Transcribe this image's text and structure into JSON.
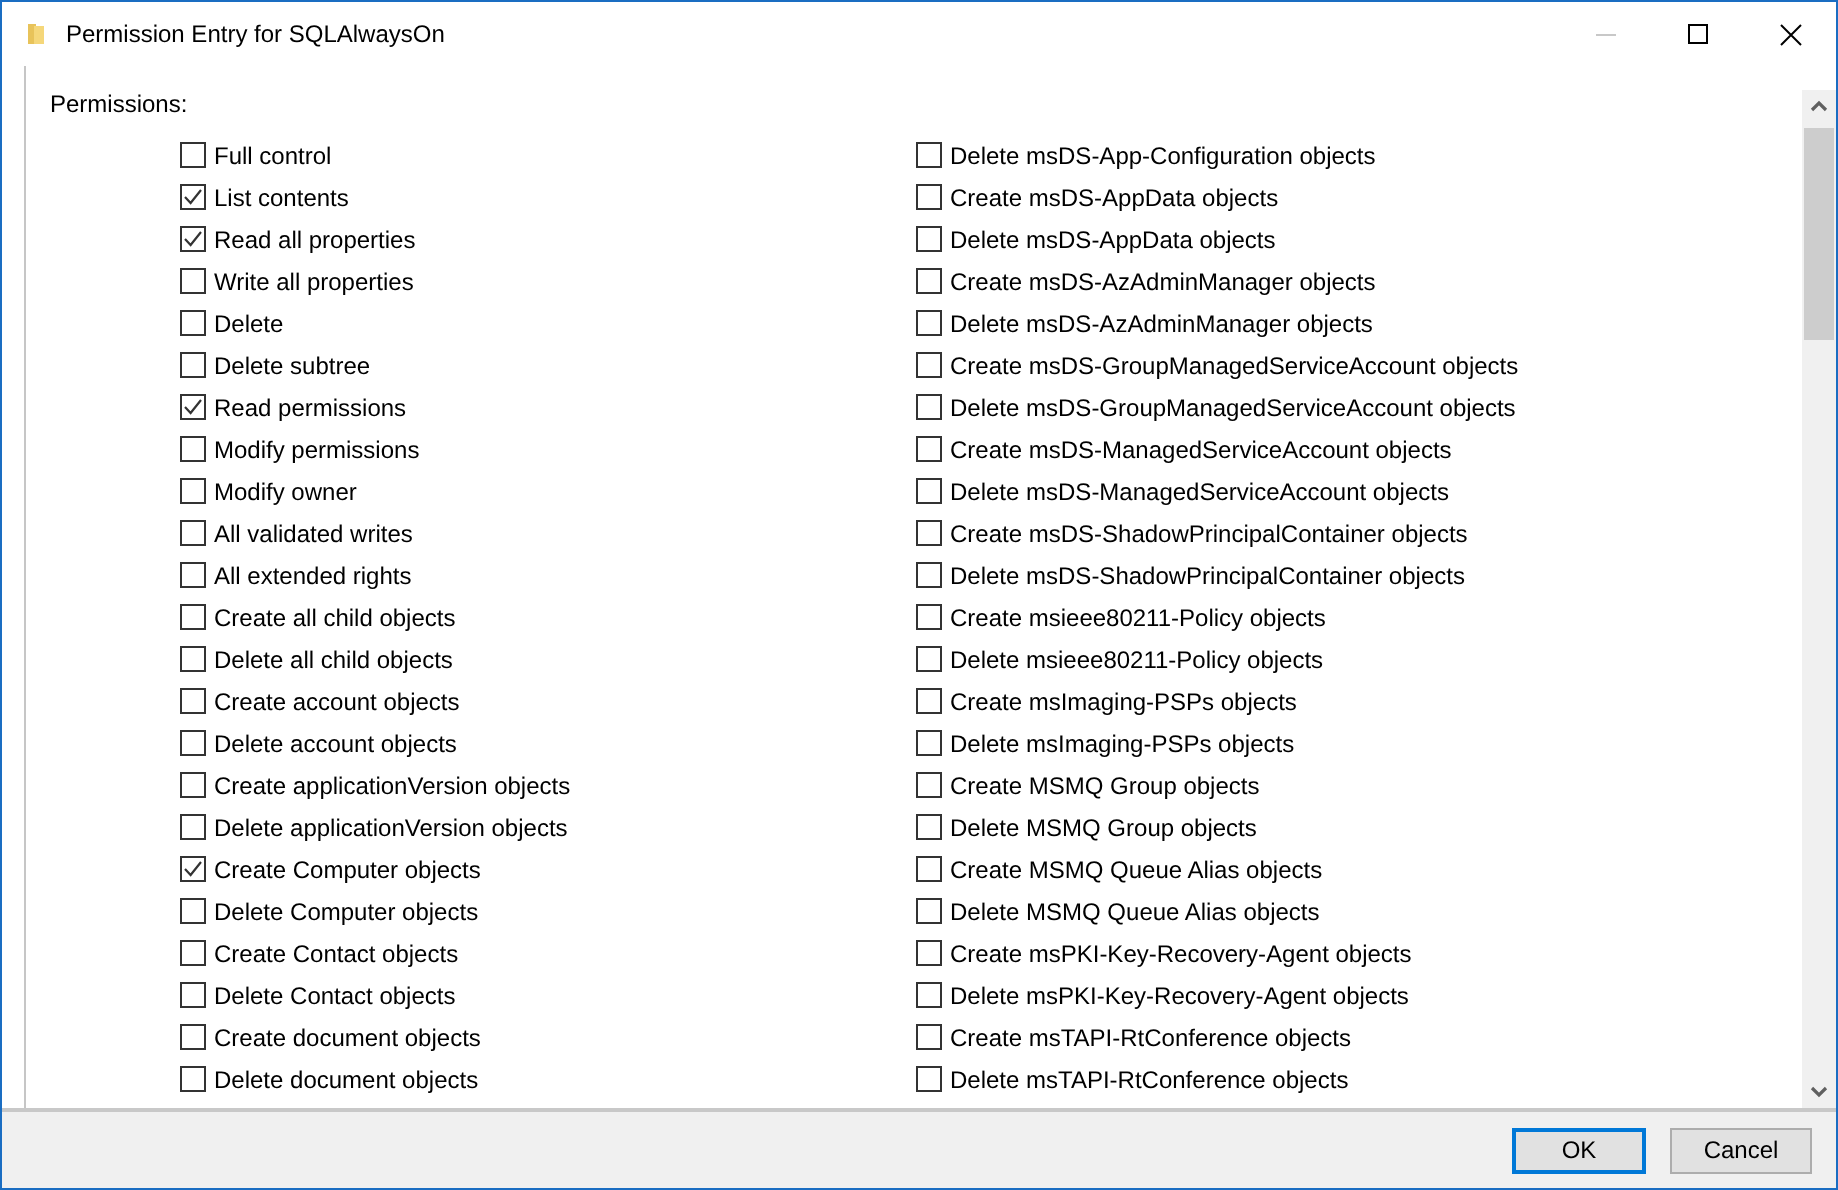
{
  "window": {
    "title": "Permission Entry for SQLAlwaysOn",
    "minimize_disabled": true
  },
  "permissions": {
    "label": "Permissions:",
    "columns": [
      {
        "items": [
          {
            "label": "Full control",
            "checked": false
          },
          {
            "label": "List contents",
            "checked": true
          },
          {
            "label": "Read all properties",
            "checked": true
          },
          {
            "label": "Write all properties",
            "checked": false
          },
          {
            "label": "Delete",
            "checked": false
          },
          {
            "label": "Delete subtree",
            "checked": false
          },
          {
            "label": "Read permissions",
            "checked": true
          },
          {
            "label": "Modify permissions",
            "checked": false
          },
          {
            "label": "Modify owner",
            "checked": false
          },
          {
            "label": "All validated writes",
            "checked": false
          },
          {
            "label": "All extended rights",
            "checked": false
          },
          {
            "label": "Create all child objects",
            "checked": false
          },
          {
            "label": "Delete all child objects",
            "checked": false
          },
          {
            "label": "Create account objects",
            "checked": false
          },
          {
            "label": "Delete account objects",
            "checked": false
          },
          {
            "label": "Create applicationVersion objects",
            "checked": false
          },
          {
            "label": "Delete applicationVersion objects",
            "checked": false
          },
          {
            "label": "Create Computer objects",
            "checked": true
          },
          {
            "label": "Delete Computer objects",
            "checked": false
          },
          {
            "label": "Create Contact objects",
            "checked": false
          },
          {
            "label": "Delete Contact objects",
            "checked": false
          },
          {
            "label": "Create document objects",
            "checked": false
          },
          {
            "label": "Delete document objects",
            "checked": false
          }
        ]
      },
      {
        "items": [
          {
            "label": "Delete msDS-App-Configuration objects",
            "checked": false
          },
          {
            "label": "Create msDS-AppData objects",
            "checked": false
          },
          {
            "label": "Delete msDS-AppData objects",
            "checked": false
          },
          {
            "label": "Create msDS-AzAdminManager objects",
            "checked": false
          },
          {
            "label": "Delete msDS-AzAdminManager objects",
            "checked": false
          },
          {
            "label": "Create msDS-GroupManagedServiceAccount objects",
            "checked": false
          },
          {
            "label": "Delete msDS-GroupManagedServiceAccount objects",
            "checked": false
          },
          {
            "label": "Create msDS-ManagedServiceAccount objects",
            "checked": false
          },
          {
            "label": "Delete msDS-ManagedServiceAccount objects",
            "checked": false
          },
          {
            "label": "Create msDS-ShadowPrincipalContainer objects",
            "checked": false
          },
          {
            "label": "Delete msDS-ShadowPrincipalContainer objects",
            "checked": false
          },
          {
            "label": "Create msieee80211-Policy objects",
            "checked": false
          },
          {
            "label": "Delete msieee80211-Policy objects",
            "checked": false
          },
          {
            "label": "Create msImaging-PSPs objects",
            "checked": false
          },
          {
            "label": "Delete msImaging-PSPs objects",
            "checked": false
          },
          {
            "label": "Create MSMQ Group objects",
            "checked": false
          },
          {
            "label": "Delete MSMQ Group objects",
            "checked": false
          },
          {
            "label": "Create MSMQ Queue Alias objects",
            "checked": false
          },
          {
            "label": "Delete MSMQ Queue Alias objects",
            "checked": false
          },
          {
            "label": "Create msPKI-Key-Recovery-Agent objects",
            "checked": false
          },
          {
            "label": "Delete msPKI-Key-Recovery-Agent objects",
            "checked": false
          },
          {
            "label": "Create msTAPI-RtConference objects",
            "checked": false
          },
          {
            "label": "Delete msTAPI-RtConference objects",
            "checked": false
          }
        ]
      }
    ]
  },
  "buttons": [
    {
      "label": "OK",
      "default": true
    },
    {
      "label": "Cancel",
      "default": false
    }
  ]
}
